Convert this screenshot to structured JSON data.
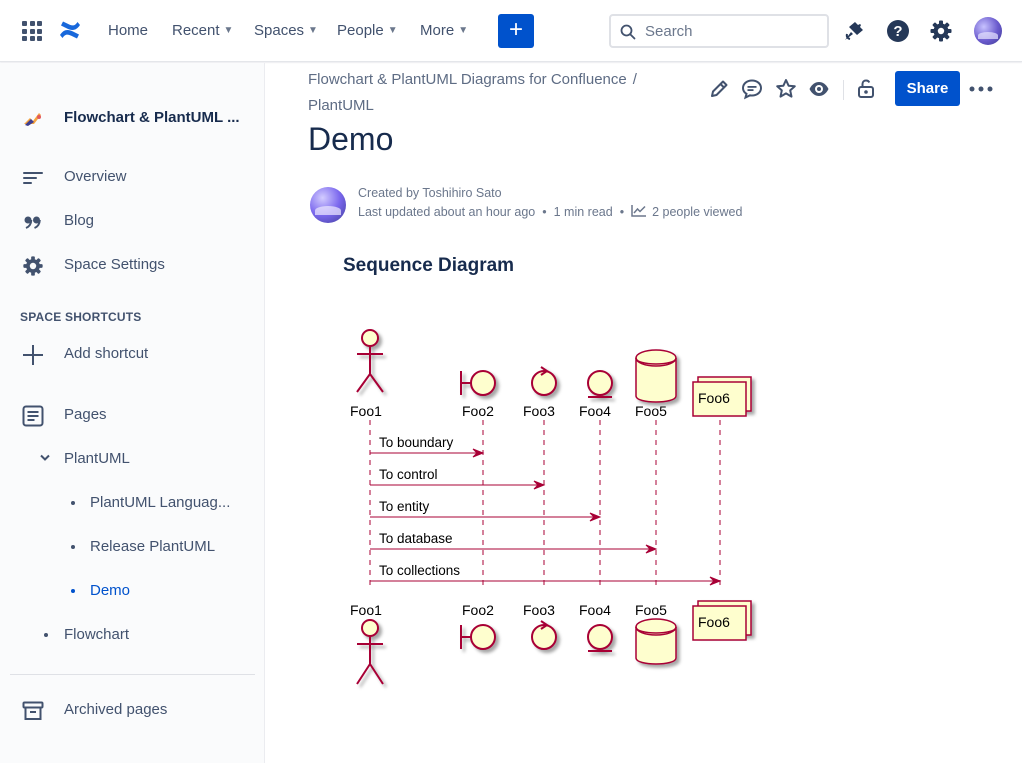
{
  "topnav": {
    "items": [
      {
        "label": "Home",
        "has_chevron": false
      },
      {
        "label": "Recent",
        "has_chevron": true
      },
      {
        "label": "Spaces",
        "has_chevron": true
      },
      {
        "label": "People",
        "has_chevron": true
      },
      {
        "label": "More",
        "has_chevron": true
      }
    ],
    "create_label": "+",
    "search_placeholder": "Search",
    "icons": [
      "apps-grid-icon",
      "confluence-logo-icon",
      "notifications-icon",
      "help-icon",
      "settings-icon",
      "profile-avatar"
    ]
  },
  "sidebar": {
    "space_name": "Flowchart & PlantUML ...",
    "items": [
      {
        "label": "Overview",
        "icon": "overview-icon"
      },
      {
        "label": "Blog",
        "icon": "blog-quote-icon"
      },
      {
        "label": "Space Settings",
        "icon": "gear-icon"
      }
    ],
    "shortcuts_heading": "SPACE SHORTCUTS",
    "add_shortcut": "Add shortcut",
    "pages_label": "Pages",
    "tree": [
      {
        "label": "PlantUML",
        "level": 1,
        "expanded": true
      },
      {
        "label": "PlantUML Languag...",
        "level": 2
      },
      {
        "label": "Release PlantUML",
        "level": 2
      },
      {
        "label": "Demo",
        "level": 2,
        "active": true
      },
      {
        "label": "Flowchart",
        "level": 1
      }
    ],
    "archived": "Archived pages"
  },
  "breadcrumb": {
    "parent": "Flowchart & PlantUML Diagrams for Confluence",
    "separator": "/",
    "current": "PlantUML"
  },
  "actions": {
    "share_label": "Share",
    "icons": [
      "edit-icon",
      "comment-icon",
      "star-icon",
      "watch-icon",
      "restrictions-icon",
      "more-icon"
    ]
  },
  "page": {
    "title": "Demo",
    "created_by": "Created by Toshihiro Sato",
    "last_updated": "Last updated about an hour ago",
    "read_time": "1 min read",
    "views": "2 people viewed",
    "section_heading": "Sequence Diagram"
  },
  "diagram": {
    "participants": [
      {
        "name": "Foo1",
        "kind": "actor"
      },
      {
        "name": "Foo2",
        "kind": "boundary"
      },
      {
        "name": "Foo3",
        "kind": "control"
      },
      {
        "name": "Foo4",
        "kind": "entity"
      },
      {
        "name": "Foo5",
        "kind": "database"
      },
      {
        "name": "Foo6",
        "kind": "collections"
      }
    ],
    "messages": [
      {
        "from": "Foo1",
        "to": "Foo2",
        "label": "To boundary"
      },
      {
        "from": "Foo1",
        "to": "Foo3",
        "label": "To control"
      },
      {
        "from": "Foo1",
        "to": "Foo4",
        "label": "To entity"
      },
      {
        "from": "Foo1",
        "to": "Foo5",
        "label": "To database"
      },
      {
        "from": "Foo1",
        "to": "Foo6",
        "label": "To collections"
      }
    ],
    "colors": {
      "stroke": "#a80036",
      "fill": "#fefece"
    }
  }
}
